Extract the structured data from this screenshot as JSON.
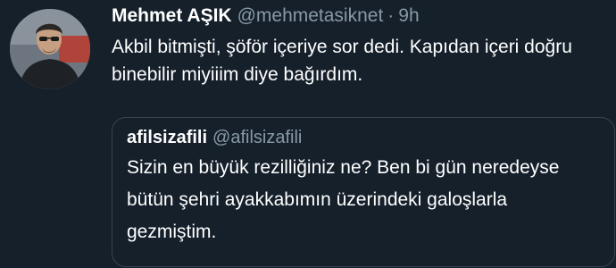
{
  "tweet": {
    "author_name": "Mehmet AŞIK",
    "author_handle": "@mehmetasiknet",
    "separator": "·",
    "time": "9h",
    "text": "Akbil bitmişti, şöför içeriye sor dedi. Kapıdan içeri doğru binebilir miyiiim diye bağırdım."
  },
  "quoted_tweet": {
    "author_name": "afilsizafili",
    "author_handle": "@afilsizafili",
    "text": "Sizin en büyük rezilliğiniz ne? Ben bi gün neredeyse bütün şehri ayakkabımın üzerindeki galoşlarla gezmiştim."
  },
  "colors": {
    "background": "#15202b",
    "primary_text": "#ffffff",
    "secondary_text": "#8899a6",
    "border": "#38444d"
  }
}
